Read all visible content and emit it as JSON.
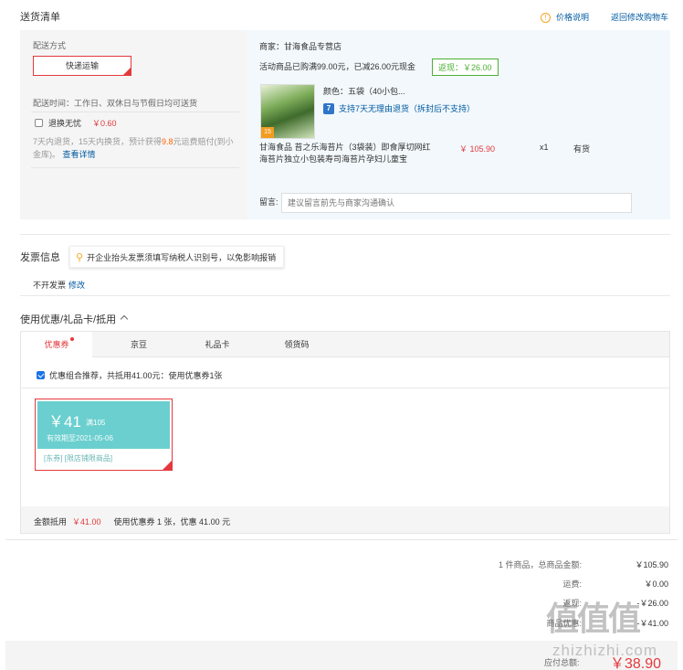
{
  "header": {
    "title": "送货清单",
    "price_note": "价格说明",
    "back_to_cart": "返回修改购物车"
  },
  "shipping": {
    "method_label": "配送方式",
    "method_value": "快递运输",
    "time": "配送时间：工作日、双休日与节假日均可送货",
    "insurance_label": "退换无忧",
    "insurance_price": "￥0.60",
    "insurance_desc": "7天内退货，15天内换货，预计获得",
    "insurance_amount": "9.8",
    "insurance_desc2": "元运费赔付(到小金库)。",
    "insurance_more": "查看详情"
  },
  "order": {
    "shop": "商家：甘海食品专营店",
    "promo": "活动商品已购满99.00元，已减26.00元现金",
    "rebate": "返现：￥26.00",
    "color": "颜色：五袋（40小包...",
    "return_icon": "7",
    "return_policy": "支持7天无理由退货（拆封后不支持）",
    "product_name": "甘海食品 苔之乐海苔片（3袋装）即食厚切网红海苔片独立小包装寿司海苔片孕妇儿童宝",
    "price": "￥ 105.90",
    "qty": "x1",
    "stock": "有货",
    "note_label": "留言:",
    "note_placeholder": "建议留言前先与商家沟通确认"
  },
  "invoice": {
    "title": "发票信息",
    "tip": "开企业抬头发票须填写纳税人识别号，以免影响报销",
    "status": "不开发票",
    "edit": "修改"
  },
  "coupons": {
    "title": "使用优惠/礼品卡/抵用",
    "tabs": [
      "优惠券",
      "京豆",
      "礼品卡",
      "领货码"
    ],
    "combo": "优惠组合推荐，共抵用41.00元：使用优惠券1张",
    "card": {
      "amount": "￥41",
      "condition": "满105",
      "expiry": "有效期至2021-05-06",
      "scope": "[东券] [限店铺限商品]"
    },
    "footer_label": "金额抵用",
    "footer_amount": "￥41.00",
    "footer_desc": "使用优惠券 1 张，优惠 41.00 元"
  },
  "summary": {
    "items_label": "1 件商品，总商品金额:",
    "items_value": "￥105.90",
    "freight_label": "运费:",
    "freight_value": "￥0.00",
    "rebate_label": "返现:",
    "rebate_value": "-￥26.00",
    "coupon_label": "商品优惠:",
    "coupon_value": "-￥41.00",
    "pay_label": "应付总额:",
    "pay_value": "￥38.90"
  },
  "watermark": {
    "logo": "值值值",
    "url": "zhizhizhi.com"
  }
}
